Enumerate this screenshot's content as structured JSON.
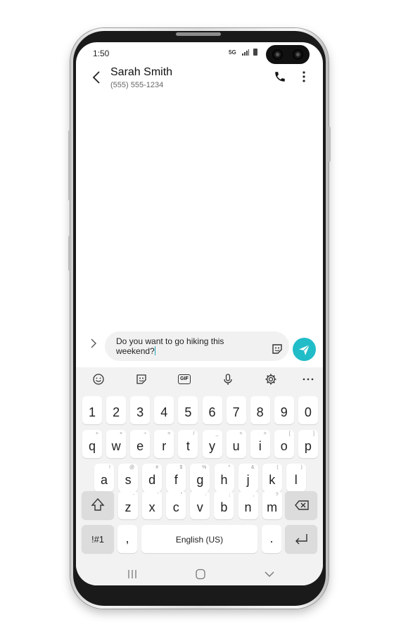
{
  "status_bar": {
    "time": "1:50",
    "network": "5G"
  },
  "header": {
    "contact_name": "Sarah Smith",
    "contact_phone": "(555) 555-1234"
  },
  "compose": {
    "text": "Do you want to go hiking this weekend?"
  },
  "keyboard": {
    "number_row": [
      "1",
      "2",
      "3",
      "4",
      "5",
      "6",
      "7",
      "8",
      "9",
      "0"
    ],
    "row1": [
      {
        "key": "q",
        "alt": "+"
      },
      {
        "key": "w",
        "alt": "×"
      },
      {
        "key": "e",
        "alt": "÷"
      },
      {
        "key": "r",
        "alt": "="
      },
      {
        "key": "t",
        "alt": "/"
      },
      {
        "key": "y",
        "alt": "_"
      },
      {
        "key": "u",
        "alt": "<"
      },
      {
        "key": "i",
        "alt": ">"
      },
      {
        "key": "o",
        "alt": "["
      },
      {
        "key": "p",
        "alt": "]"
      }
    ],
    "row2": [
      {
        "key": "a",
        "alt": "!"
      },
      {
        "key": "s",
        "alt": "@"
      },
      {
        "key": "d",
        "alt": "#"
      },
      {
        "key": "f",
        "alt": "$"
      },
      {
        "key": "g",
        "alt": "%"
      },
      {
        "key": "h",
        "alt": "^"
      },
      {
        "key": "j",
        "alt": "&"
      },
      {
        "key": "k",
        "alt": "("
      },
      {
        "key": "l",
        "alt": ")"
      }
    ],
    "row3": [
      {
        "key": "z",
        "alt": "-"
      },
      {
        "key": "x",
        "alt": "'"
      },
      {
        "key": "c",
        "alt": "\""
      },
      {
        "key": "v",
        "alt": ":"
      },
      {
        "key": "b",
        "alt": ";"
      },
      {
        "key": "n",
        "alt": ","
      },
      {
        "key": "m",
        "alt": "?"
      }
    ],
    "symbols_label": "!#1",
    "comma": ",",
    "space_label": "English (US)",
    "period": ".",
    "toolbar_gif": "GIF"
  },
  "icons": {
    "back": "chevron-left-icon",
    "call": "phone-icon",
    "more": "more-vertical-icon",
    "expand": "chevron-right-icon",
    "sticker": "sticker-icon",
    "send": "send-icon",
    "emoji": "emoji-icon",
    "gif": "gif-icon",
    "mic": "microphone-icon",
    "settings": "gear-icon",
    "toolbar_more": "more-horizontal-icon",
    "shift": "shift-icon",
    "backspace": "backspace-icon",
    "enter": "enter-icon",
    "recents": "recents-icon",
    "home": "home-icon",
    "nav_back": "chevron-down-icon"
  },
  "colors": {
    "accent": "#20bcc8",
    "keyboard_bg": "#f2f2f2",
    "compose_bg": "#f1f1f1"
  }
}
